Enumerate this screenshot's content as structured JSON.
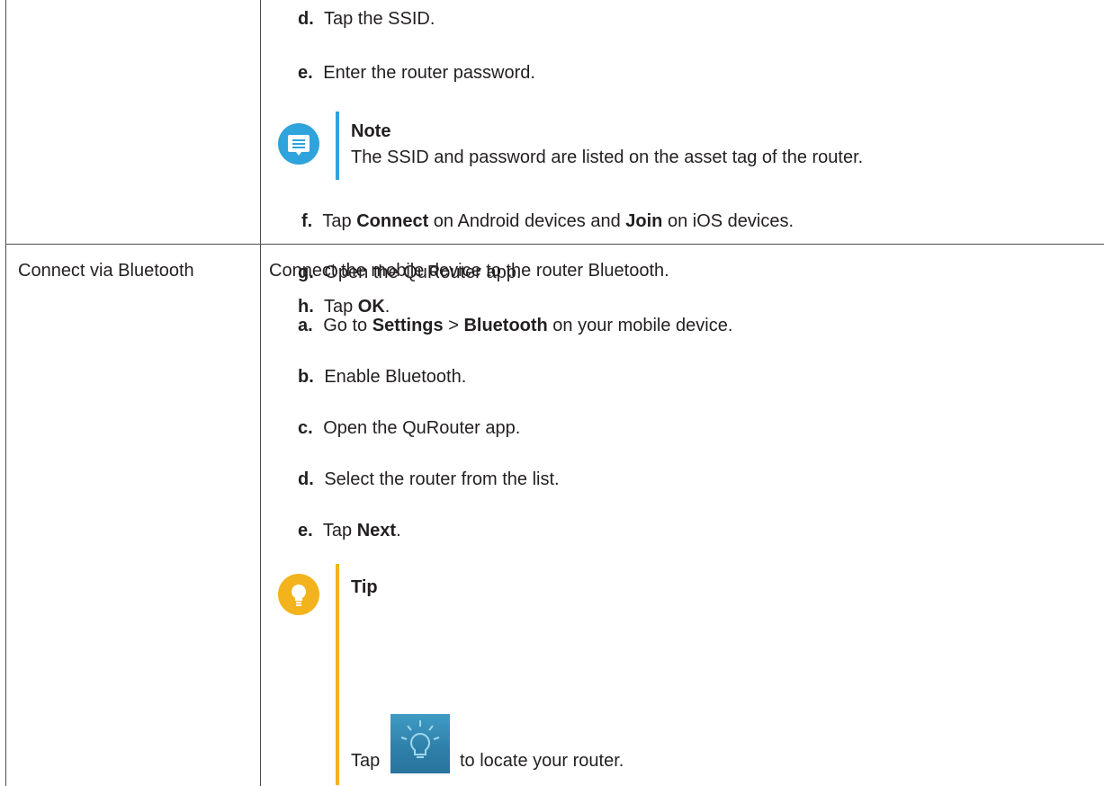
{
  "row1": {
    "steps": [
      {
        "letter": "d.",
        "parts": [
          {
            "t": "Tap the SSID."
          }
        ]
      },
      {
        "letter": "e.",
        "parts": [
          {
            "t": "Enter the router password."
          }
        ]
      },
      {
        "letter": "f.",
        "parts": [
          {
            "t": "Tap "
          },
          {
            "t": "Connect",
            "b": true
          },
          {
            "t": " on Android devices and "
          },
          {
            "t": "Join",
            "b": true
          },
          {
            "t": " on iOS devices."
          }
        ]
      },
      {
        "letter": "g.",
        "parts": [
          {
            "t": "Open the QuRouter app."
          }
        ]
      },
      {
        "letter": "h.",
        "parts": [
          {
            "t": "Tap "
          },
          {
            "t": "OK",
            "b": true
          },
          {
            "t": "."
          }
        ]
      }
    ],
    "note": {
      "title": "Note",
      "text": "The SSID and password are listed on the asset tag of the router.",
      "icon": "note-icon",
      "color": "#2ea3dc"
    }
  },
  "row2": {
    "method": "Connect via Bluetooth",
    "intro": "Connect the mobile device to the router Bluetooth.",
    "steps": [
      {
        "letter": "a.",
        "parts": [
          {
            "t": "Go to "
          },
          {
            "t": "Settings",
            "b": true
          },
          {
            "t": " > "
          },
          {
            "t": "Bluetooth",
            "b": true
          },
          {
            "t": " on your mobile device."
          }
        ]
      },
      {
        "letter": "b.",
        "parts": [
          {
            "t": "Enable Bluetooth."
          }
        ]
      },
      {
        "letter": "c.",
        "parts": [
          {
            "t": "Open the QuRouter app."
          }
        ]
      },
      {
        "letter": "d.",
        "parts": [
          {
            "t": "Select the router from the list."
          }
        ]
      },
      {
        "letter": "e.",
        "parts": [
          {
            "t": "Tap "
          },
          {
            "t": "Next",
            "b": true
          },
          {
            "t": "."
          }
        ]
      }
    ],
    "tip": {
      "title": "Tip",
      "text_before": "Tap",
      "text_after": "to locate your router.",
      "icon": "lightbulb-icon",
      "inline_icon": "locate-lightbulb-icon",
      "color": "#f2b31d"
    }
  }
}
